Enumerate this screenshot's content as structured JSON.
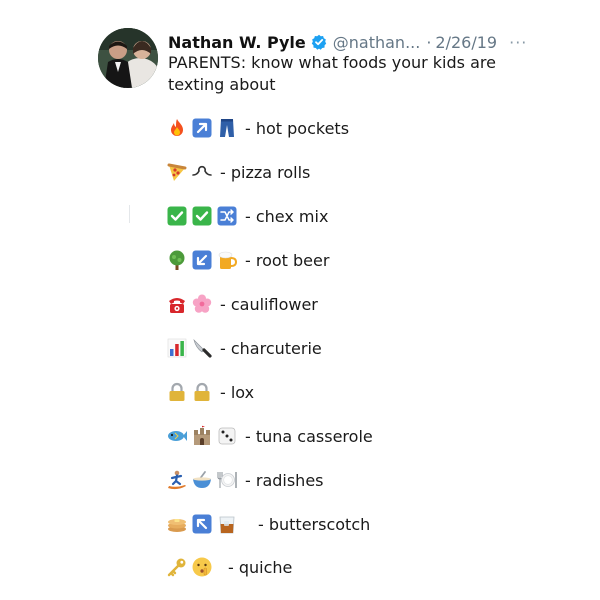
{
  "tweet": {
    "author_name": "Nathan W. Pyle",
    "handle": "@nathan...",
    "separator": "·",
    "date": "2/26/19",
    "more_label": "···",
    "text": "PARENTS: know what foods your kids are texting about",
    "verified": true
  },
  "colors": {
    "name": "#111111",
    "meta": "#657786",
    "verified": "#1da1f2",
    "keycap_blue": "#4a7fd6",
    "check_green": "#3ab54a"
  },
  "items": [
    {
      "icons": [
        "fire-emoji",
        "arrow-up-right-emoji",
        "jeans-emoji"
      ],
      "label": "- hot pockets"
    },
    {
      "icons": [
        "pizza-emoji",
        "curly-loop-emoji"
      ],
      "label": "- pizza rolls"
    },
    {
      "icons": [
        "check-mark-emoji",
        "check-mark-emoji",
        "shuffle-emoji"
      ],
      "label": "- chex mix"
    },
    {
      "icons": [
        "tree-emoji",
        "arrow-down-left-emoji",
        "beer-mug-emoji"
      ],
      "label": "- root beer"
    },
    {
      "icons": [
        "telephone-emoji",
        "cherry-blossom-emoji"
      ],
      "label": "- cauliflower"
    },
    {
      "icons": [
        "bar-chart-emoji",
        "knife-emoji"
      ],
      "label": "- charcuterie"
    },
    {
      "icons": [
        "lock-emoji",
        "lock-emoji"
      ],
      "label": "- lox"
    },
    {
      "icons": [
        "fish-emoji",
        "castle-emoji",
        "dice-emoji"
      ],
      "label": "- tuna casserole"
    },
    {
      "icons": [
        "person-surfing-emoji",
        "bowl-with-spoon-emoji",
        "plate-emoji"
      ],
      "label": "- radishes"
    },
    {
      "icons": [
        "pancakes-emoji",
        "arrow-up-left-emoji",
        "whiskey-emoji"
      ],
      "label": "- butterscotch"
    },
    {
      "icons": [
        "key-emoji",
        "shushing-face-emoji"
      ],
      "label": "- quiche"
    }
  ]
}
